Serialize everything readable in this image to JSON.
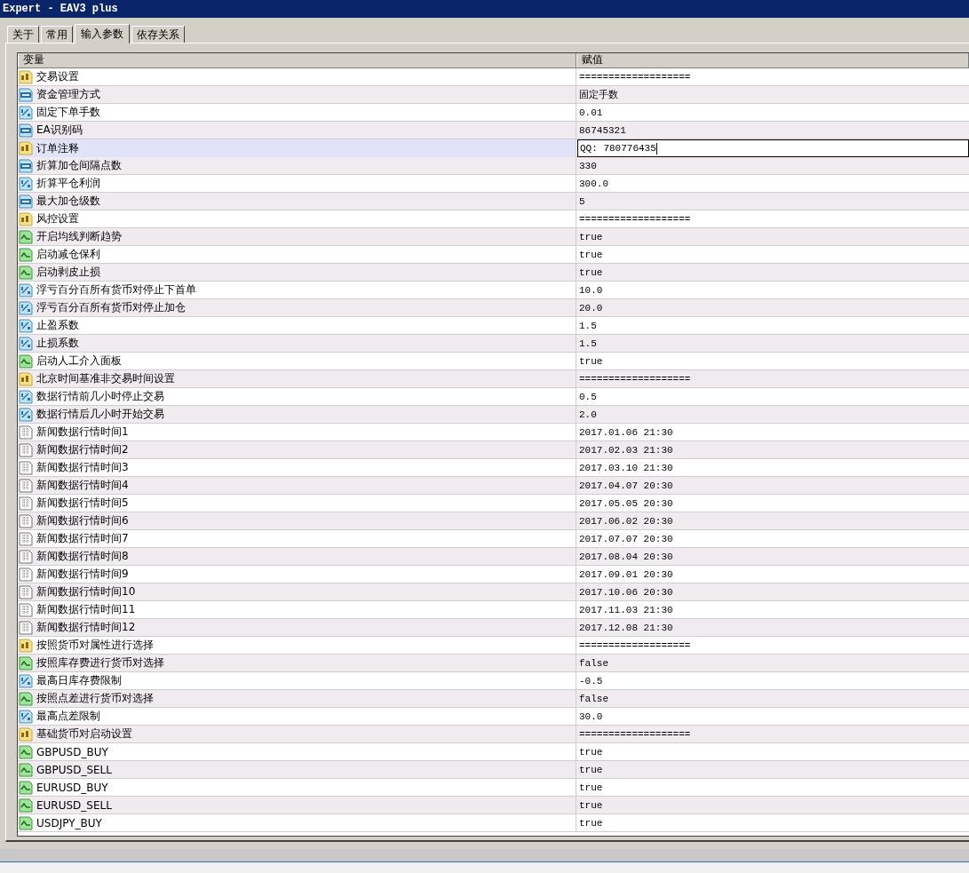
{
  "window": {
    "title": "Expert - EAV3 plus"
  },
  "tabs": [
    {
      "label": "关于",
      "selected": false
    },
    {
      "label": "常用",
      "selected": false
    },
    {
      "label": "输入参数",
      "selected": true
    },
    {
      "label": "依存关系",
      "selected": false
    }
  ],
  "table": {
    "columns": [
      "变量",
      "赋值"
    ],
    "rows": [
      {
        "kind": "string",
        "name": "交易设置",
        "value": "===================",
        "selected": false
      },
      {
        "kind": "int",
        "name": "资金管理方式",
        "value": "固定手数",
        "selected": false
      },
      {
        "kind": "double",
        "name": "固定下单手数",
        "value": "0.01",
        "selected": false
      },
      {
        "kind": "int",
        "name": "EA识别码",
        "value": "86745321",
        "selected": false
      },
      {
        "kind": "string",
        "name": "订单注释",
        "value": "QQ: 780776435",
        "selected": true
      },
      {
        "kind": "int",
        "name": "折算加仓间隔点数",
        "value": "330",
        "selected": false
      },
      {
        "kind": "double",
        "name": "折算平仓利润",
        "value": "300.0",
        "selected": false
      },
      {
        "kind": "int",
        "name": "最大加仓级数",
        "value": "5",
        "selected": false
      },
      {
        "kind": "string",
        "name": "风控设置",
        "value": "===================",
        "selected": false
      },
      {
        "kind": "bool",
        "name": "开启均线判断趋势",
        "value": "true",
        "selected": false
      },
      {
        "kind": "bool",
        "name": "启动减仓保利",
        "value": "true",
        "selected": false
      },
      {
        "kind": "bool",
        "name": "启动剥皮止损",
        "value": "true",
        "selected": false
      },
      {
        "kind": "double",
        "name": "浮亏百分百所有货币对停止下首单",
        "value": "10.0",
        "selected": false
      },
      {
        "kind": "double",
        "name": "浮亏百分百所有货币对停止加仓",
        "value": "20.0",
        "selected": false
      },
      {
        "kind": "double",
        "name": "止盈系数",
        "value": "1.5",
        "selected": false
      },
      {
        "kind": "double",
        "name": "止损系数",
        "value": "1.5",
        "selected": false
      },
      {
        "kind": "bool",
        "name": "启动人工介入面板",
        "value": "true",
        "selected": false
      },
      {
        "kind": "string",
        "name": "北京时间基准非交易时间设置",
        "value": "===================",
        "selected": false
      },
      {
        "kind": "double",
        "name": "数据行情前几小时停止交易",
        "value": "0.5",
        "selected": false
      },
      {
        "kind": "double",
        "name": "数据行情后几小时开始交易",
        "value": "2.0",
        "selected": false
      },
      {
        "kind": "datetime",
        "name": "新闻数据行情时间1",
        "value": "2017.01.06 21:30",
        "selected": false
      },
      {
        "kind": "datetime",
        "name": "新闻数据行情时间2",
        "value": "2017.02.03 21:30",
        "selected": false
      },
      {
        "kind": "datetime",
        "name": "新闻数据行情时间3",
        "value": "2017.03.10 21:30",
        "selected": false
      },
      {
        "kind": "datetime",
        "name": "新闻数据行情时间4",
        "value": "2017.04.07 20:30",
        "selected": false
      },
      {
        "kind": "datetime",
        "name": "新闻数据行情时间5",
        "value": "2017.05.05 20:30",
        "selected": false
      },
      {
        "kind": "datetime",
        "name": "新闻数据行情时间6",
        "value": "2017.06.02 20:30",
        "selected": false
      },
      {
        "kind": "datetime",
        "name": "新闻数据行情时间7",
        "value": "2017.07.07 20:30",
        "selected": false
      },
      {
        "kind": "datetime",
        "name": "新闻数据行情时间8",
        "value": "2017.08.04 20:30",
        "selected": false
      },
      {
        "kind": "datetime",
        "name": "新闻数据行情时间9",
        "value": "2017.09.01 20:30",
        "selected": false
      },
      {
        "kind": "datetime",
        "name": "新闻数据行情时间10",
        "value": "2017.10.06 20:30",
        "selected": false
      },
      {
        "kind": "datetime",
        "name": "新闻数据行情时间11",
        "value": "2017.11.03 21:30",
        "selected": false
      },
      {
        "kind": "datetime",
        "name": "新闻数据行情时间12",
        "value": "2017.12.08 21:30",
        "selected": false
      },
      {
        "kind": "string",
        "name": "按照货币对属性进行选择",
        "value": "===================",
        "selected": false
      },
      {
        "kind": "bool",
        "name": "按照库存费进行货币对选择",
        "value": "false",
        "selected": false
      },
      {
        "kind": "double",
        "name": "最高日库存费限制",
        "value": "-0.5",
        "selected": false
      },
      {
        "kind": "bool",
        "name": "按照点差进行货币对选择",
        "value": "false",
        "selected": false
      },
      {
        "kind": "double",
        "name": "最高点差限制",
        "value": "30.0",
        "selected": false
      },
      {
        "kind": "string",
        "name": "基础货币对启动设置",
        "value": "===================",
        "selected": false
      },
      {
        "kind": "bool",
        "name": "GBPUSD_BUY",
        "value": "true",
        "selected": false
      },
      {
        "kind": "bool",
        "name": "GBPUSD_SELL",
        "value": "true",
        "selected": false
      },
      {
        "kind": "bool",
        "name": "EURUSD_BUY",
        "value": "true",
        "selected": false
      },
      {
        "kind": "bool",
        "name": "EURUSD_SELL",
        "value": "true",
        "selected": false
      },
      {
        "kind": "bool",
        "name": "USDJPY_BUY",
        "value": "true",
        "selected": false
      }
    ]
  }
}
